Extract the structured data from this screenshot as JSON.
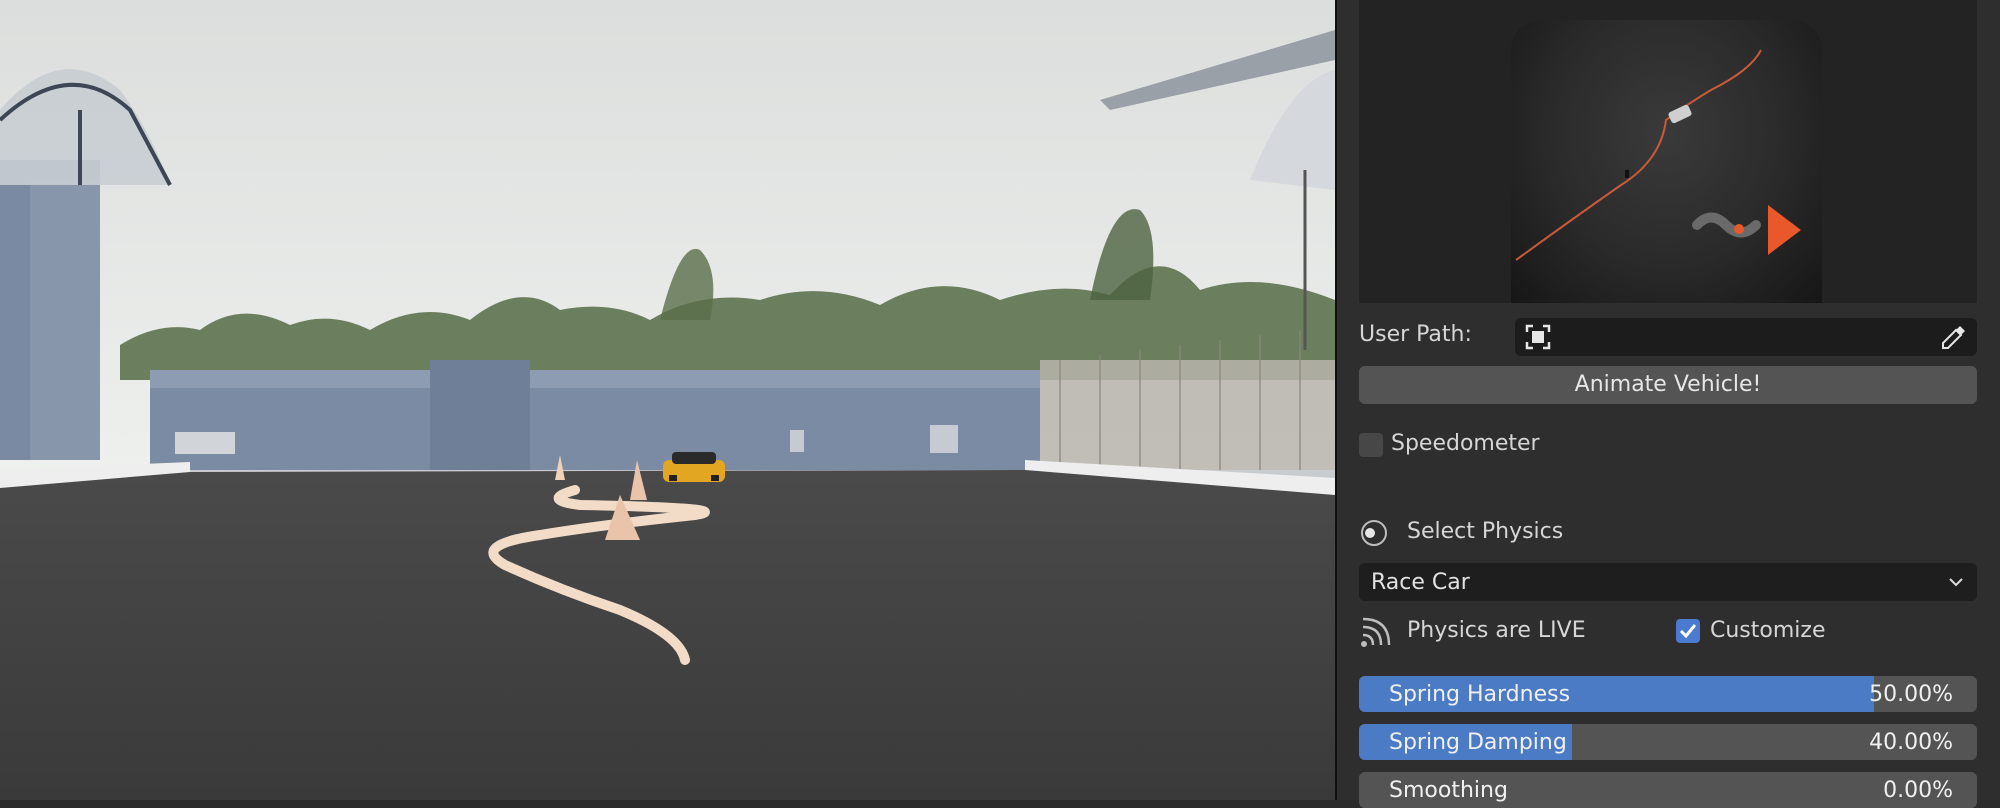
{
  "panel": {
    "user_path_label": "User Path:",
    "user_path_value": "",
    "animate_button_label": "Animate Vehicle!",
    "speedometer_label": "Speedometer",
    "speedometer_checked": false,
    "select_physics_label": "Select Physics",
    "physics_selected": "Race Car",
    "physics_live_label": "Physics are LIVE",
    "customize_label": "Customize",
    "customize_checked": true,
    "sliders": [
      {
        "label": "Spring Hardness",
        "value": "50.00%",
        "fraction": 0.833
      },
      {
        "label": "Spring Damping",
        "value": "40.00%",
        "fraction": 0.345
      },
      {
        "label": "Smoothing",
        "value": "0.00%",
        "fraction": 0.0
      }
    ]
  },
  "icons": {
    "user_path_pick": "square-select-icon",
    "user_path_eyedropper": "eyedropper-icon",
    "select_physics": "radio-target-icon",
    "physics_live": "signal-arcs-icon",
    "dropdown": "chevron-down-icon",
    "preview_logo": "play-logo-icon"
  },
  "colors": {
    "panel_bg": "#2e2e2e",
    "slider_fill": "#4a7bc4",
    "checkbox_on": "#4a7bd0",
    "logo_orange": "#e8582a",
    "path_color": "#f2dcc8"
  }
}
